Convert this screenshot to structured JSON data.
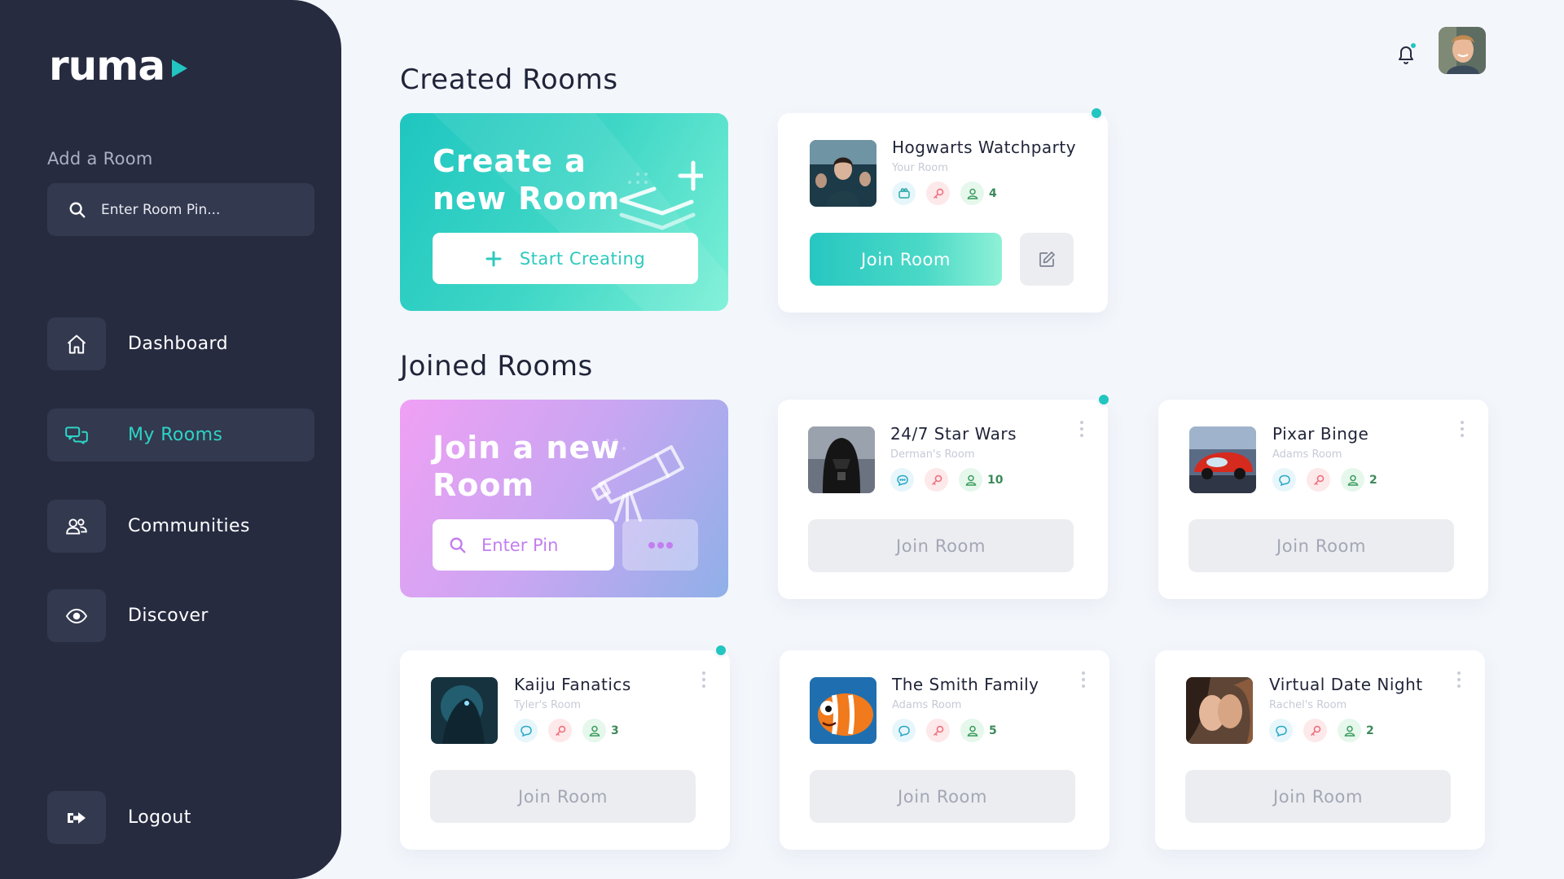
{
  "brand": {
    "name": "ruma"
  },
  "sidebar": {
    "add_room_label": "Add a Room",
    "pin_placeholder": "Enter Room Pin...",
    "nav": [
      {
        "label": "Dashboard",
        "icon": "home-icon"
      },
      {
        "label": "My Rooms",
        "icon": "chat-icon",
        "active": true
      },
      {
        "label": "Communities",
        "icon": "users-icon"
      },
      {
        "label": "Discover",
        "icon": "eye-icon"
      }
    ],
    "logout_label": "Logout"
  },
  "colors": {
    "accent": "#22c5c0",
    "sidebar": "#262b40",
    "join_gradient_start": "#f0a0f4",
    "create_gradient_start": "#1ec6c0"
  },
  "created": {
    "title": "Created Rooms",
    "create_card": {
      "title_line1": "Create a",
      "title_line2": "new Room",
      "button_label": "Start Creating"
    },
    "rooms": [
      {
        "name": "Hogwarts Watchparty",
        "owner": "Your Room",
        "members": "4",
        "join_label": "Join Room",
        "unread": true
      }
    ]
  },
  "joined": {
    "title": "Joined Rooms",
    "join_card": {
      "title_line1": "Join a new",
      "title_line2": "Room",
      "pin_placeholder": "Enter Pin"
    },
    "rooms": [
      {
        "name": "24/7 Star Wars",
        "owner": "Derman's Room",
        "members": "10",
        "join_label": "Join Room",
        "unread": true
      },
      {
        "name": "Pixar Binge",
        "owner": "Adams Room",
        "members": "2",
        "join_label": "Join Room",
        "unread": false
      },
      {
        "name": "Kaiju Fanatics",
        "owner": "Tyler's Room",
        "members": "3",
        "join_label": "Join Room",
        "unread": true
      },
      {
        "name": "The Smith Family",
        "owner": "Adams Room",
        "members": "5",
        "join_label": "Join Room",
        "unread": false
      },
      {
        "name": "Virtual Date Night",
        "owner": "Rachel's Room",
        "members": "2",
        "join_label": "Join Room",
        "unread": false
      }
    ]
  },
  "header": {
    "notification_icon": "bell-icon",
    "has_notification": true
  }
}
